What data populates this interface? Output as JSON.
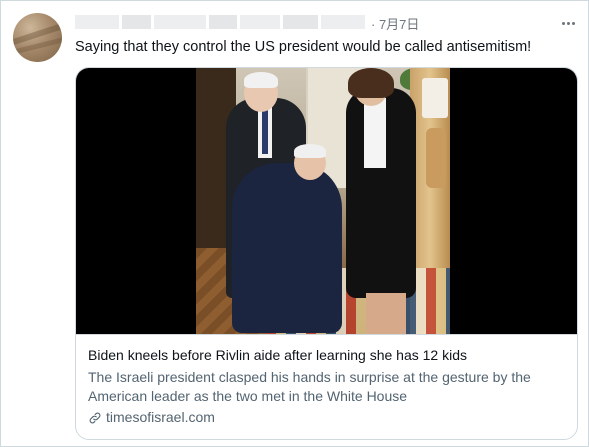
{
  "tweet": {
    "date": "· 7月7日",
    "text": "Saying that they control the US president would be called antisemitism!"
  },
  "card": {
    "title": "Biden kneels before Rivlin aide after learning she has 12 kids",
    "description": "The Israeli president clasped his hands in surprise at the gesture by the American leader as the two met in the White House",
    "domain": "timesofisrael.com",
    "link_icon": "link-icon"
  },
  "icons": {
    "more": "more-options-icon",
    "avatar": "avatar"
  },
  "colors": {
    "text": "#0f1419",
    "secondary": "#536471",
    "border": "#cfd9de"
  }
}
